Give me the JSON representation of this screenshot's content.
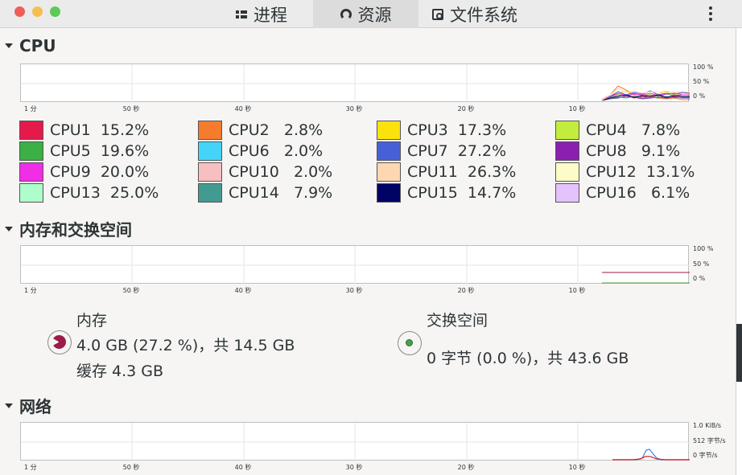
{
  "window": {
    "tabs": [
      {
        "label": "进程",
        "icon": "process-list-icon"
      },
      {
        "label": "资源",
        "icon": "resources-gauge-icon"
      },
      {
        "label": "文件系统",
        "icon": "filesystem-disk-icon"
      }
    ],
    "active_tab": "资源"
  },
  "cpu": {
    "title": "CPU",
    "y_ticks": [
      "100 %",
      "50 %",
      "0 %"
    ],
    "x_ticks": [
      "1 分",
      "50 秒",
      "40 秒",
      "30 秒",
      "20 秒",
      "10 秒"
    ],
    "cores": [
      {
        "name": "CPU1",
        "value": "15.2%",
        "color": "#e31a4b"
      },
      {
        "name": "CPU2",
        "value": "2.8%",
        "color": "#f47c2c"
      },
      {
        "name": "CPU3",
        "value": "17.3%",
        "color": "#fbe20c"
      },
      {
        "name": "CPU4",
        "value": "7.8%",
        "color": "#c3ec3f"
      },
      {
        "name": "CPU5",
        "value": "19.6%",
        "color": "#3caf45"
      },
      {
        "name": "CPU6",
        "value": "2.0%",
        "color": "#45d4f9"
      },
      {
        "name": "CPU7",
        "value": "27.2%",
        "color": "#4760d8"
      },
      {
        "name": "CPU8",
        "value": "9.1%",
        "color": "#8b1fb0"
      },
      {
        "name": "CPU9",
        "value": "20.0%",
        "color": "#ef2ee6"
      },
      {
        "name": "CPU10",
        "value": "2.0%",
        "color": "#f8bfc0"
      },
      {
        "name": "CPU11",
        "value": "26.3%",
        "color": "#fdd7b2"
      },
      {
        "name": "CPU12",
        "value": "13.1%",
        "color": "#fdfbc8"
      },
      {
        "name": "CPU13",
        "value": "25.0%",
        "color": "#aefdca"
      },
      {
        "name": "CPU14",
        "value": "7.9%",
        "color": "#429b91"
      },
      {
        "name": "CPU15",
        "value": "14.7%",
        "color": "#010266"
      },
      {
        "name": "CPU16",
        "value": "6.1%",
        "color": "#e4c2fb"
      }
    ]
  },
  "memory": {
    "title": "内存和交换空间",
    "y_ticks": [
      "100 %",
      "50 %",
      "0 %"
    ],
    "x_ticks": [
      "1 分",
      "50 秒",
      "40 秒",
      "30 秒",
      "20 秒",
      "10 秒"
    ],
    "ram": {
      "label": "内存",
      "usage": "4.0 GB (27.2 %)，共 14.5 GB",
      "cache": "缓存 4.3 GB",
      "color": "#9b1b4a",
      "fraction": 0.272
    },
    "swap": {
      "label": "交换空间",
      "usage": "0 字节 (0.0 %)，共 43.6 GB",
      "color": "#4aa04a",
      "fraction": 0.0
    }
  },
  "network": {
    "title": "网络",
    "y_ticks": [
      "1.0 KiB/s",
      "512 字节/s",
      "0 字节/s"
    ],
    "x_ticks": [
      "1 分",
      "50 秒",
      "40 秒",
      "30 秒",
      "20 秒",
      "10 秒"
    ]
  }
}
